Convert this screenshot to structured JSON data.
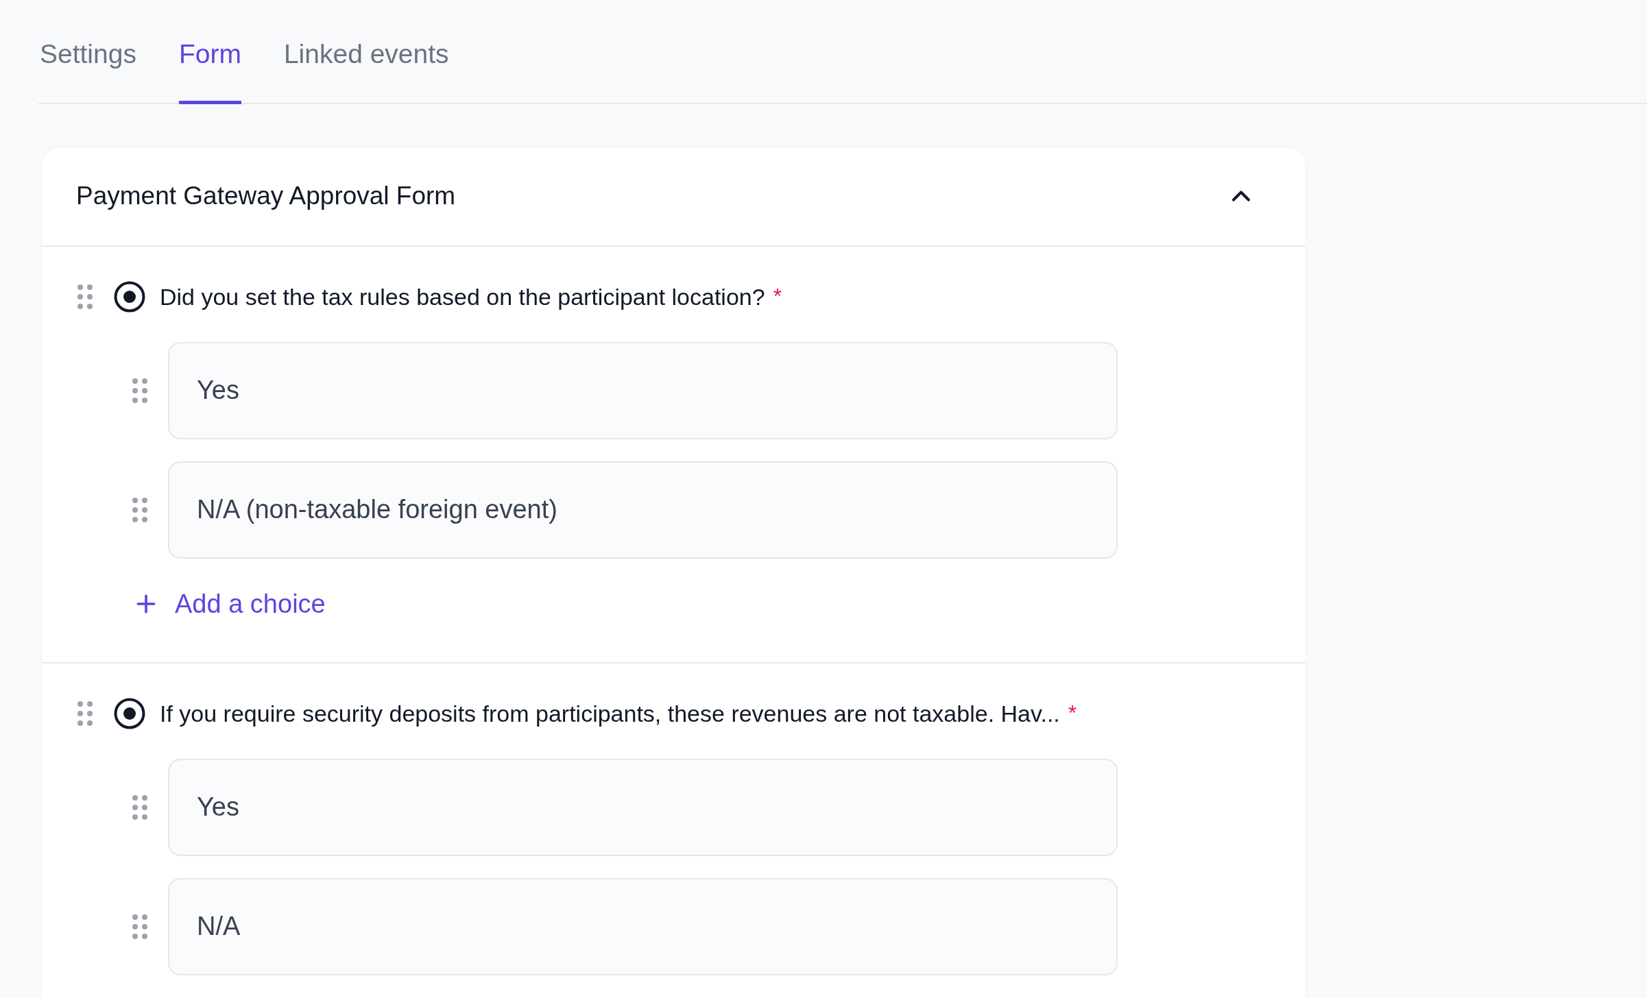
{
  "tabs": [
    {
      "label": "Settings",
      "selected": false
    },
    {
      "label": "Form",
      "selected": true
    },
    {
      "label": "Linked events",
      "selected": false
    }
  ],
  "form": {
    "title": "Payment Gateway Approval Form",
    "expanded": true,
    "questions": [
      {
        "text": "Did you set the tax rules based on the participant location?",
        "required_mark": "*",
        "choices": [
          "Yes",
          "N/A (non-taxable foreign event)"
        ],
        "add_choice": "Add a choice"
      },
      {
        "text": "If you require security deposits from participants, these revenues are not taxable. Hav...",
        "required_mark": "*",
        "choices": [
          "Yes",
          "N/A"
        ]
      }
    ]
  }
}
